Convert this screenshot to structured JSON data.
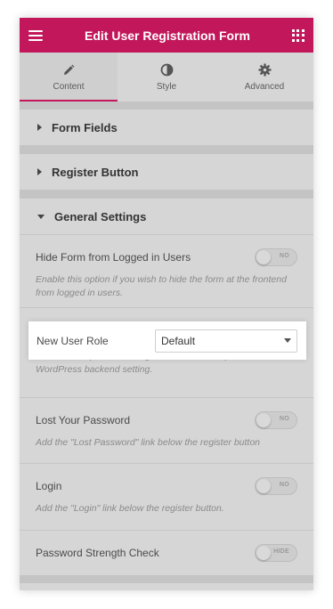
{
  "header": {
    "title": "Edit User Registration Form"
  },
  "tabs": [
    {
      "label": "Content",
      "icon": "pencil-icon",
      "active": true
    },
    {
      "label": "Style",
      "icon": "contrast-icon",
      "active": false
    },
    {
      "label": "Advanced",
      "icon": "gear-icon",
      "active": false
    }
  ],
  "sections": {
    "form_fields": "Form Fields",
    "register_button": "Register Button",
    "general_settings": "General Settings"
  },
  "controls": {
    "hide_form": {
      "label": "Hide Form from Logged in Users",
      "toggle": "NO",
      "description": "Enable this option if you wish to hide the form at the frontend from logged in users."
    },
    "new_user_role": {
      "label": "New User Role",
      "value": "Default",
      "description": "The default option will assign the user role as per the WordPress backend setting."
    },
    "lost_password": {
      "label": "Lost Your Password",
      "toggle": "NO",
      "description": "Add the \"Lost Password\" link below the register button"
    },
    "login": {
      "label": "Login",
      "toggle": "NO",
      "description": "Add the \"Login\" link below the register button."
    },
    "password_strength": {
      "label": "Password Strength Check",
      "toggle": "HIDE"
    }
  },
  "colors": {
    "accent": "#c2185b"
  }
}
